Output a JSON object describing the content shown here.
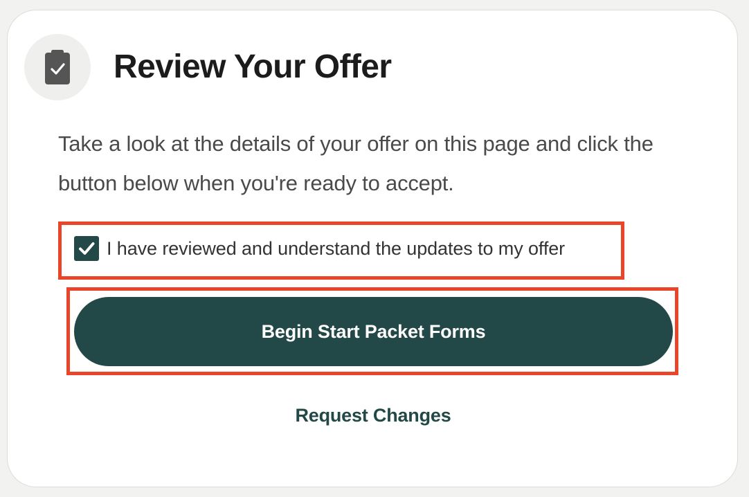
{
  "card": {
    "title": "Review Your Offer",
    "icon": "clipboard-check-icon",
    "description": "Take a look at the details of your offer on this page and click the button below when you're ready to accept."
  },
  "acknowledgement": {
    "label": "I have reviewed and understand the updates to my offer",
    "checked": true
  },
  "actions": {
    "primary_label": "Begin Start Packet Forms",
    "secondary_label": "Request Changes"
  },
  "colors": {
    "accent": "#234848",
    "highlight": "#e8452a",
    "icon_background": "#efefed"
  }
}
